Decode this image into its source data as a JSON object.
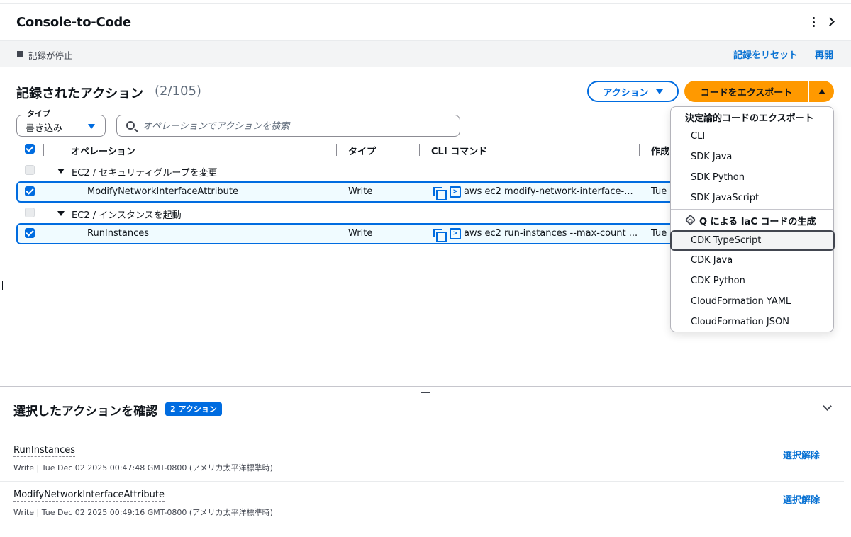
{
  "header": {
    "title": "Console-to-Code"
  },
  "status": {
    "text": "記録が停止",
    "reset_label": "記録をリセット",
    "resume_label": "再開"
  },
  "section": {
    "title": "記録されたアクション",
    "count": "(2/105)"
  },
  "toolbar": {
    "action_label": "アクション",
    "export_label": "コードをエクスポート"
  },
  "filter": {
    "type_legend": "タイプ",
    "type_value": "書き込み",
    "search_placeholder": "オペレーションでアクションを検索"
  },
  "table": {
    "columns": [
      "オペレーション",
      "タイプ",
      "CLI コマンド",
      "作成"
    ],
    "groups": [
      {
        "label": "EC2 / セキュリティグループを変更",
        "rows": [
          {
            "operation": "ModifyNetworkInterfaceAttribute",
            "type": "Write",
            "cli": "aws ec2 modify-network-interface-...",
            "created": "Tue"
          }
        ]
      },
      {
        "label": "EC2 / インスタンスを起動",
        "rows": [
          {
            "operation": "RunInstances",
            "type": "Write",
            "cli": "aws ec2 run-instances --max-count ...",
            "created": "Tue"
          }
        ]
      }
    ]
  },
  "dropdown": {
    "deterministic_header": "決定論的コードのエクスポート",
    "deterministic_items": [
      "CLI",
      "SDK Java",
      "SDK Python",
      "SDK JavaScript"
    ],
    "q_header": "Q による IaC コードの生成",
    "q_items": [
      "CDK TypeScript",
      "CDK Java",
      "CDK Python",
      "CloudFormation YAML",
      "CloudFormation JSON"
    ],
    "highlighted": "CDK TypeScript"
  },
  "review": {
    "title": "選択したアクションを確認",
    "badge": "2 アクション",
    "items": [
      {
        "name": "RunInstances",
        "meta": "Write | Tue Dec 02 2025 00:47:48 GMT-0800 (アメリカ太平洋標準時)",
        "deselect": "選択解除"
      },
      {
        "name": "ModifyNetworkInterfaceAttribute",
        "meta": "Write | Tue Dec 02 2025 00:49:16 GMT-0800 (アメリカ太平洋標準時)",
        "deselect": "選択解除"
      }
    ]
  },
  "colors": {
    "accent": "#006ce0",
    "export_button": "#ff9900",
    "link": "#0972d3"
  }
}
